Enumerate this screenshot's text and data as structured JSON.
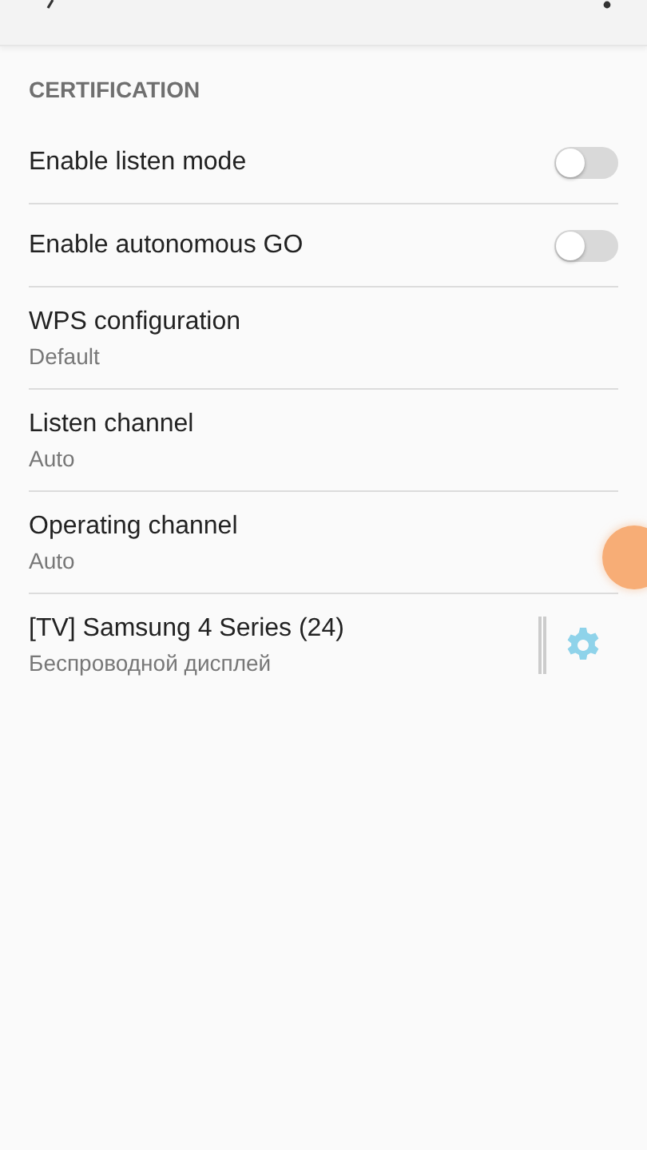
{
  "section": {
    "title": "CERTIFICATION"
  },
  "items": [
    {
      "kind": "toggle",
      "label": "Enable listen mode",
      "on": false
    },
    {
      "kind": "toggle",
      "label": "Enable autonomous GO",
      "on": false
    },
    {
      "kind": "value",
      "label": "WPS configuration",
      "summary": "Default"
    },
    {
      "kind": "value",
      "label": "Listen channel",
      "summary": "Auto"
    },
    {
      "kind": "value",
      "label": "Operating channel",
      "summary": "Auto"
    },
    {
      "kind": "device",
      "label": "[TV] Samsung 4 Series (24)",
      "summary": "Беспроводной дисплей"
    }
  ]
}
